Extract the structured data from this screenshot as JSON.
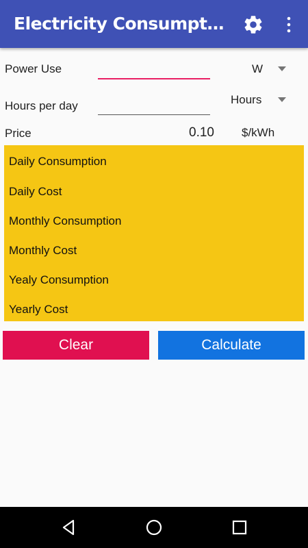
{
  "app_bar": {
    "title": "Electricity Consumption B...",
    "settings_icon": "gear-icon",
    "more_icon": "more-vert-icon"
  },
  "form": {
    "power_use": {
      "label": "Power Use",
      "value": "",
      "unit": "W"
    },
    "hours_per_day": {
      "label": "Hours per day",
      "value": "",
      "unit": "Hours"
    },
    "price": {
      "label": "Price",
      "value": "0.10",
      "unit": "$/kWh"
    }
  },
  "results": [
    "Daily Consumption",
    "Daily Cost",
    "Monthly Consumption",
    "Monthly Cost",
    "Yealy Consumption",
    "Yearly Cost"
  ],
  "buttons": {
    "clear": "Clear",
    "calculate": "Calculate"
  },
  "colors": {
    "app_bar": "#3f51b5",
    "results_bg": "#f5c614",
    "clear_button": "#e01050",
    "calculate_button": "#1273e0",
    "focus_underline": "#e91e63"
  },
  "nav_bar": {
    "back_icon": "back-icon",
    "home_icon": "home-icon",
    "recents_icon": "recents-icon"
  }
}
